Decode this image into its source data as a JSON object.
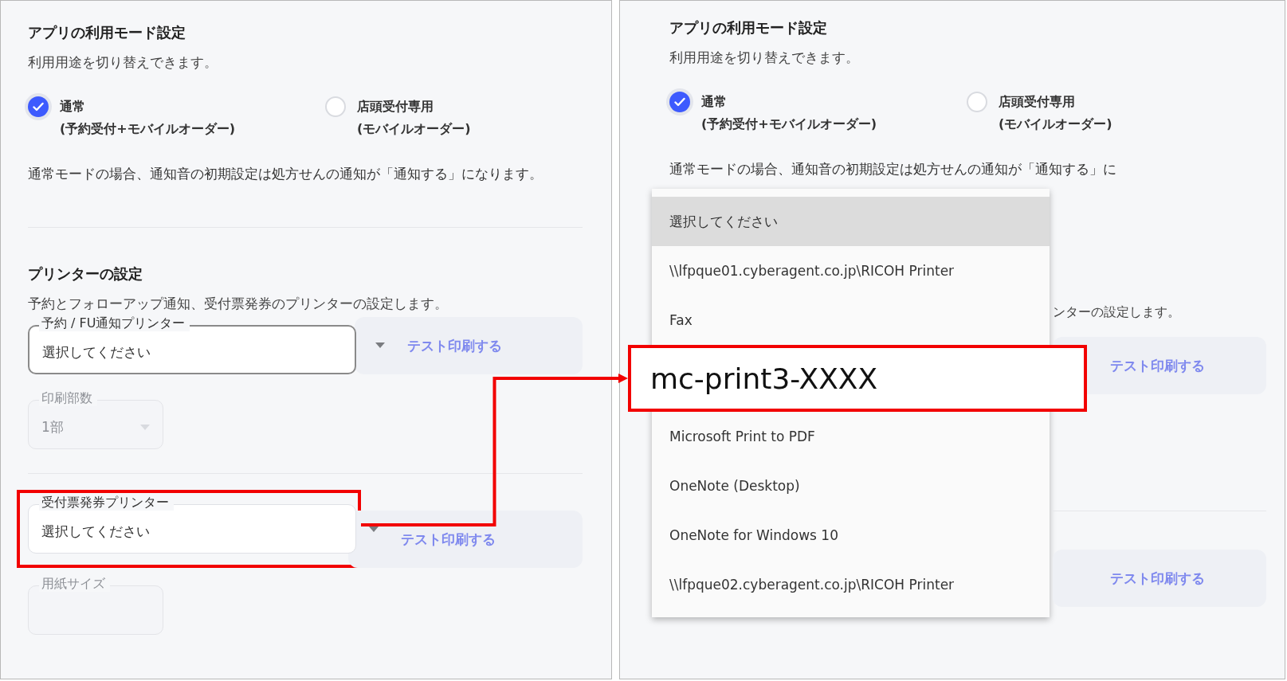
{
  "left_panel": {
    "mode_section": {
      "title": "アプリの利用モード設定",
      "description": "利用用途を切り替えできます。",
      "options": [
        {
          "label": "通常",
          "sublabel": "(予約受付+モバイルオーダー)",
          "selected": true
        },
        {
          "label": "店頭受付専用",
          "sublabel": "(モバイルオーダー)",
          "selected": false
        }
      ],
      "note": "通常モードの場合、通知音の初期設定は処方せんの通知が「通知する」になります。"
    },
    "printer_section": {
      "title": "プリンターの設定",
      "description": "予約とフォローアップ通知、受付票発券のプリンターの設定します。",
      "printers": [
        {
          "label": "予約 / FU通知プリンター",
          "value": "選択してください",
          "focused": true,
          "callout": false,
          "test_button": {
            "label": "テスト印刷する",
            "disabled": true
          },
          "copies": {
            "label": "印刷部数",
            "value": "1部",
            "disabled": true
          }
        },
        {
          "label": "受付票発券プリンター",
          "value": "選択してください",
          "focused": false,
          "callout": true,
          "test_button": {
            "label": "テスト印刷する",
            "disabled": true
          },
          "copies": {
            "label": "用紙サイズ",
            "disabled": true
          }
        }
      ]
    }
  },
  "right_panel": {
    "mode_section": {
      "title": "アプリの利用モード設定",
      "description": "利用用途を切り替えできます。",
      "options": [
        {
          "label": "通常",
          "sublabel": "(予約受付+モバイルオーダー)",
          "selected": true
        },
        {
          "label": "店頭受付専用",
          "sublabel": "(モバイルオーダー)",
          "selected": false
        }
      ],
      "note": "通常モードの場合、通知音の初期設定は処方せんの通知が「通知する」に"
    },
    "description_fragment": "ンターの設定します。",
    "test_buttons": [
      {
        "label": "テスト印刷する",
        "disabled": true
      },
      {
        "label": "テスト印刷する",
        "disabled": true
      }
    ],
    "dropdown_menu": {
      "items": [
        {
          "label": "選択してください",
          "selected": true,
          "kind": "option"
        },
        {
          "label": "\\\\lfpque01.cyberagent.co.jp\\RICOH Printer",
          "selected": false,
          "kind": "option"
        },
        {
          "label": "Fax",
          "selected": false,
          "kind": "option"
        },
        {
          "label": "mc-print3-XXXX",
          "selected": false,
          "kind": "callout"
        },
        {
          "label": "Microsoft Print to PDF",
          "selected": false,
          "kind": "option"
        },
        {
          "label": "OneNote (Desktop)",
          "selected": false,
          "kind": "option"
        },
        {
          "label": "OneNote for Windows 10",
          "selected": false,
          "kind": "option"
        },
        {
          "label": "\\\\lfpque02.cyberagent.co.jp\\RICOH Printer",
          "selected": false,
          "kind": "option"
        }
      ]
    }
  }
}
